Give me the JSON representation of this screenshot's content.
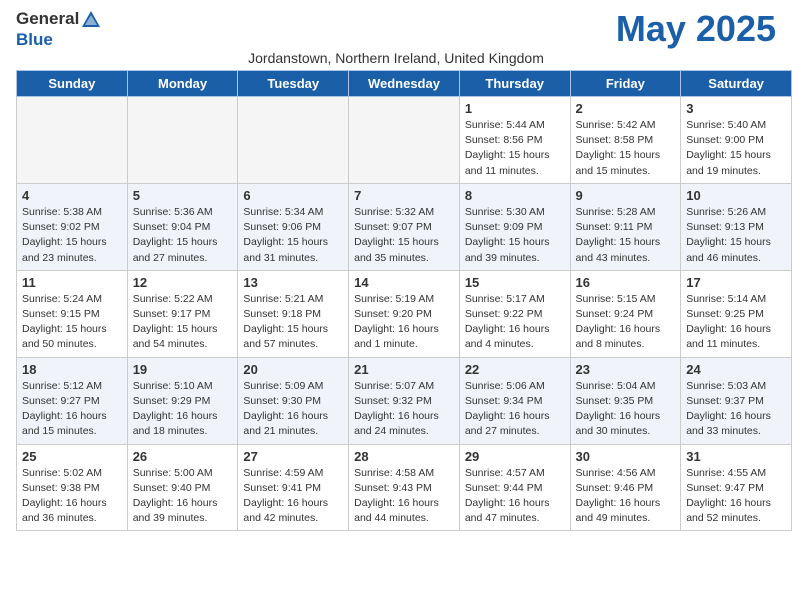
{
  "header": {
    "logo_general": "General",
    "logo_blue": "Blue",
    "month_title": "May 2025",
    "location": "Jordanstown, Northern Ireland, United Kingdom"
  },
  "weekdays": [
    "Sunday",
    "Monday",
    "Tuesday",
    "Wednesday",
    "Thursday",
    "Friday",
    "Saturday"
  ],
  "weeks": [
    [
      {
        "day": "",
        "info": "",
        "empty": true
      },
      {
        "day": "",
        "info": "",
        "empty": true
      },
      {
        "day": "",
        "info": "",
        "empty": true
      },
      {
        "day": "",
        "info": "",
        "empty": true
      },
      {
        "day": "1",
        "info": "Sunrise: 5:44 AM\nSunset: 8:56 PM\nDaylight: 15 hours\nand 11 minutes.",
        "empty": false
      },
      {
        "day": "2",
        "info": "Sunrise: 5:42 AM\nSunset: 8:58 PM\nDaylight: 15 hours\nand 15 minutes.",
        "empty": false
      },
      {
        "day": "3",
        "info": "Sunrise: 5:40 AM\nSunset: 9:00 PM\nDaylight: 15 hours\nand 19 minutes.",
        "empty": false
      }
    ],
    [
      {
        "day": "4",
        "info": "Sunrise: 5:38 AM\nSunset: 9:02 PM\nDaylight: 15 hours\nand 23 minutes.",
        "empty": false
      },
      {
        "day": "5",
        "info": "Sunrise: 5:36 AM\nSunset: 9:04 PM\nDaylight: 15 hours\nand 27 minutes.",
        "empty": false
      },
      {
        "day": "6",
        "info": "Sunrise: 5:34 AM\nSunset: 9:06 PM\nDaylight: 15 hours\nand 31 minutes.",
        "empty": false
      },
      {
        "day": "7",
        "info": "Sunrise: 5:32 AM\nSunset: 9:07 PM\nDaylight: 15 hours\nand 35 minutes.",
        "empty": false
      },
      {
        "day": "8",
        "info": "Sunrise: 5:30 AM\nSunset: 9:09 PM\nDaylight: 15 hours\nand 39 minutes.",
        "empty": false
      },
      {
        "day": "9",
        "info": "Sunrise: 5:28 AM\nSunset: 9:11 PM\nDaylight: 15 hours\nand 43 minutes.",
        "empty": false
      },
      {
        "day": "10",
        "info": "Sunrise: 5:26 AM\nSunset: 9:13 PM\nDaylight: 15 hours\nand 46 minutes.",
        "empty": false
      }
    ],
    [
      {
        "day": "11",
        "info": "Sunrise: 5:24 AM\nSunset: 9:15 PM\nDaylight: 15 hours\nand 50 minutes.",
        "empty": false
      },
      {
        "day": "12",
        "info": "Sunrise: 5:22 AM\nSunset: 9:17 PM\nDaylight: 15 hours\nand 54 minutes.",
        "empty": false
      },
      {
        "day": "13",
        "info": "Sunrise: 5:21 AM\nSunset: 9:18 PM\nDaylight: 15 hours\nand 57 minutes.",
        "empty": false
      },
      {
        "day": "14",
        "info": "Sunrise: 5:19 AM\nSunset: 9:20 PM\nDaylight: 16 hours\nand 1 minute.",
        "empty": false
      },
      {
        "day": "15",
        "info": "Sunrise: 5:17 AM\nSunset: 9:22 PM\nDaylight: 16 hours\nand 4 minutes.",
        "empty": false
      },
      {
        "day": "16",
        "info": "Sunrise: 5:15 AM\nSunset: 9:24 PM\nDaylight: 16 hours\nand 8 minutes.",
        "empty": false
      },
      {
        "day": "17",
        "info": "Sunrise: 5:14 AM\nSunset: 9:25 PM\nDaylight: 16 hours\nand 11 minutes.",
        "empty": false
      }
    ],
    [
      {
        "day": "18",
        "info": "Sunrise: 5:12 AM\nSunset: 9:27 PM\nDaylight: 16 hours\nand 15 minutes.",
        "empty": false
      },
      {
        "day": "19",
        "info": "Sunrise: 5:10 AM\nSunset: 9:29 PM\nDaylight: 16 hours\nand 18 minutes.",
        "empty": false
      },
      {
        "day": "20",
        "info": "Sunrise: 5:09 AM\nSunset: 9:30 PM\nDaylight: 16 hours\nand 21 minutes.",
        "empty": false
      },
      {
        "day": "21",
        "info": "Sunrise: 5:07 AM\nSunset: 9:32 PM\nDaylight: 16 hours\nand 24 minutes.",
        "empty": false
      },
      {
        "day": "22",
        "info": "Sunrise: 5:06 AM\nSunset: 9:34 PM\nDaylight: 16 hours\nand 27 minutes.",
        "empty": false
      },
      {
        "day": "23",
        "info": "Sunrise: 5:04 AM\nSunset: 9:35 PM\nDaylight: 16 hours\nand 30 minutes.",
        "empty": false
      },
      {
        "day": "24",
        "info": "Sunrise: 5:03 AM\nSunset: 9:37 PM\nDaylight: 16 hours\nand 33 minutes.",
        "empty": false
      }
    ],
    [
      {
        "day": "25",
        "info": "Sunrise: 5:02 AM\nSunset: 9:38 PM\nDaylight: 16 hours\nand 36 minutes.",
        "empty": false
      },
      {
        "day": "26",
        "info": "Sunrise: 5:00 AM\nSunset: 9:40 PM\nDaylight: 16 hours\nand 39 minutes.",
        "empty": false
      },
      {
        "day": "27",
        "info": "Sunrise: 4:59 AM\nSunset: 9:41 PM\nDaylight: 16 hours\nand 42 minutes.",
        "empty": false
      },
      {
        "day": "28",
        "info": "Sunrise: 4:58 AM\nSunset: 9:43 PM\nDaylight: 16 hours\nand 44 minutes.",
        "empty": false
      },
      {
        "day": "29",
        "info": "Sunrise: 4:57 AM\nSunset: 9:44 PM\nDaylight: 16 hours\nand 47 minutes.",
        "empty": false
      },
      {
        "day": "30",
        "info": "Sunrise: 4:56 AM\nSunset: 9:46 PM\nDaylight: 16 hours\nand 49 minutes.",
        "empty": false
      },
      {
        "day": "31",
        "info": "Sunrise: 4:55 AM\nSunset: 9:47 PM\nDaylight: 16 hours\nand 52 minutes.",
        "empty": false
      }
    ]
  ]
}
